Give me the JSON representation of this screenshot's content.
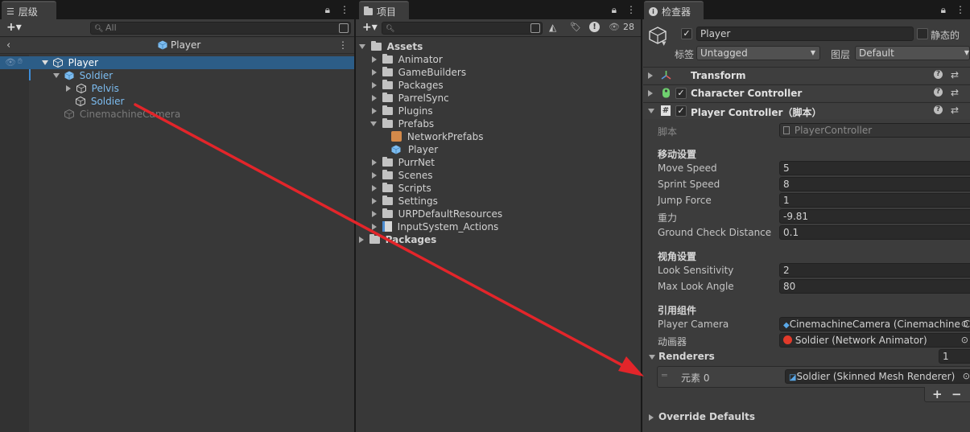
{
  "hierarchy": {
    "tab_label": "层级",
    "search_placeholder": "All",
    "scene_title": "Player",
    "items": [
      {
        "label": "Player"
      },
      {
        "label": "Soldier"
      },
      {
        "label": "Pelvis"
      },
      {
        "label": "Soldier"
      },
      {
        "label": "CinemachineCamera"
      }
    ]
  },
  "project": {
    "tab_label": "项目",
    "badge_count": "28",
    "items": [
      {
        "label": "Assets"
      },
      {
        "label": "Animator"
      },
      {
        "label": "GameBuilders"
      },
      {
        "label": "Packages"
      },
      {
        "label": "ParrelSync"
      },
      {
        "label": "Plugins"
      },
      {
        "label": "Prefabs"
      },
      {
        "label": "NetworkPrefabs"
      },
      {
        "label": "Player"
      },
      {
        "label": "PurrNet"
      },
      {
        "label": "Scenes"
      },
      {
        "label": "Scripts"
      },
      {
        "label": "Settings"
      },
      {
        "label": "URPDefaultResources"
      },
      {
        "label": "InputSystem_Actions"
      },
      {
        "label": "Packages"
      }
    ]
  },
  "inspector": {
    "tab_label": "检查器",
    "object_name": "Player",
    "static_label": "静态的",
    "tag_label": "标签",
    "tag_value": "Untagged",
    "layer_label": "图层",
    "layer_value": "Default",
    "components": [
      {
        "name": "Transform"
      },
      {
        "name": "Character Controller"
      },
      {
        "name": "Player Controller（脚本）"
      }
    ],
    "script_label": "脚本",
    "script_value": "PlayerController",
    "section_move": "移动设置",
    "move_speed_label": "Move Speed",
    "move_speed": "5",
    "sprint_speed_label": "Sprint Speed",
    "sprint_speed": "8",
    "jump_force_label": "Jump Force",
    "jump_force": "1",
    "gravity_label": "重力",
    "gravity": "-9.81",
    "ground_check_label": "Ground Check Distance",
    "ground_check": "0.1",
    "section_view": "视角设置",
    "look_sens_label": "Look Sensitivity",
    "look_sens": "2",
    "max_look_label": "Max Look Angle",
    "max_look": "80",
    "section_refs": "引用组件",
    "player_camera_label": "Player Camera",
    "player_camera_value": "CinemachineCamera (Cinemachine C",
    "animator_label": "动画器",
    "animator_value": "Soldier (Network Animator)",
    "renderers_label": "Renderers",
    "renderers_count": "1",
    "element0_label": "元素 0",
    "element0_value": "Soldier (Skinned Mesh Renderer)",
    "add_symbol": "+",
    "remove_symbol": "−",
    "override_defaults": "Override Defaults"
  },
  "colors": {
    "accent_blue": "#2c5d87",
    "arrow_red": "#e3252a",
    "prefab_blue": "#7cbcf0"
  }
}
